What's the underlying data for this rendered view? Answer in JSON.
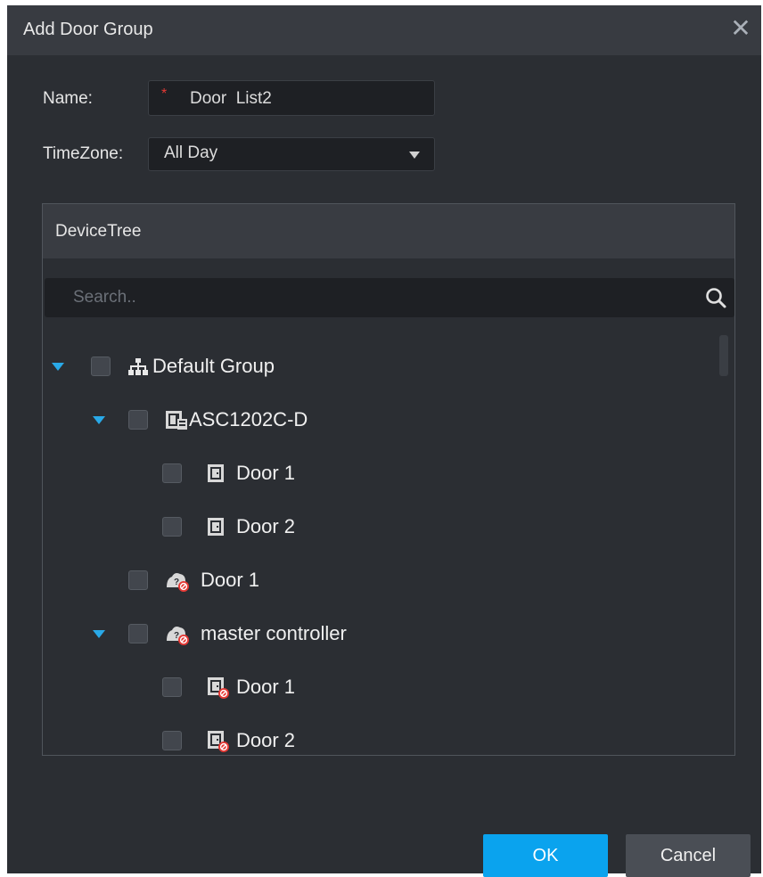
{
  "dialog": {
    "title": "Add Door Group",
    "close_glyph": "✕"
  },
  "form": {
    "name_label": "Name:",
    "name_required_mark": "*",
    "name_value": "Door  List2",
    "timezone_label": "TimeZone:",
    "timezone_value": "All Day"
  },
  "device_tree": {
    "title": "DeviceTree",
    "search_placeholder": "Search..",
    "nodes": [
      {
        "label": "Default Group",
        "icon": "group-tree-icon",
        "expanded": true,
        "checked": false
      },
      {
        "label": "ASC1202C-D",
        "icon": "access-controller-icon",
        "expanded": true,
        "checked": false
      },
      {
        "label": "Door 1",
        "icon": "door-icon",
        "checked": false
      },
      {
        "label": "Door 2",
        "icon": "door-icon",
        "checked": false
      },
      {
        "label": "Door 1",
        "icon": "offline-device-icon",
        "checked": false
      },
      {
        "label": "master controller",
        "icon": "offline-device-icon",
        "expanded": true,
        "checked": false
      },
      {
        "label": "Door 1",
        "icon": "offline-door-icon",
        "checked": false
      },
      {
        "label": "Door 2",
        "icon": "offline-door-icon",
        "checked": false
      }
    ]
  },
  "buttons": {
    "ok": "OK",
    "cancel": "Cancel"
  },
  "colors": {
    "dialog_bg": "#2b2e33",
    "titlebar_bg": "#383b41",
    "accent": "#0aa3ee",
    "expand_arrow": "#29a9e8",
    "required": "#e53935"
  }
}
